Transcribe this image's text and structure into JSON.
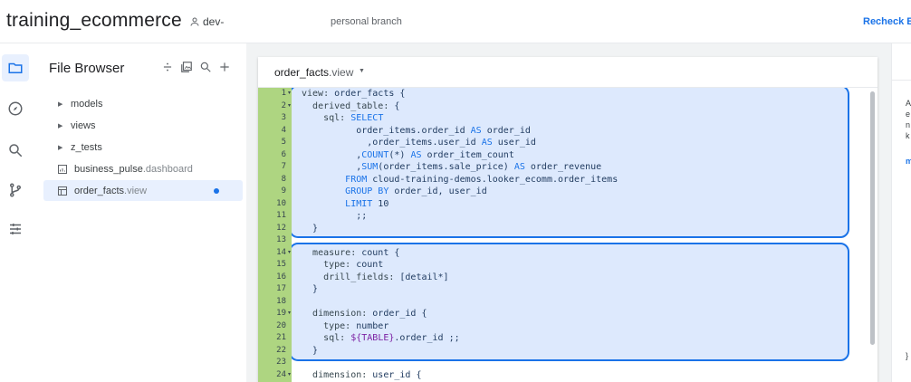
{
  "topbar": {
    "project_title": "training_ecommerce",
    "user": "dev-",
    "branch": "personal branch",
    "recheck": "Recheck Err"
  },
  "rail": {
    "items": [
      {
        "name": "folder-icon",
        "active": true
      },
      {
        "name": "compass-icon",
        "active": false
      },
      {
        "name": "search-icon",
        "active": false
      },
      {
        "name": "git-branch-icon",
        "active": false
      },
      {
        "name": "sliders-icon",
        "active": false
      }
    ]
  },
  "browser": {
    "title": "File Browser",
    "tools": [
      "divide-icon",
      "image-icon",
      "search-icon",
      "plus-icon"
    ],
    "items": [
      {
        "name": "models",
        "ext": "",
        "type": "folder"
      },
      {
        "name": "views",
        "ext": "",
        "type": "folder"
      },
      {
        "name": "z_tests",
        "ext": "",
        "type": "folder"
      },
      {
        "name": "business_pulse",
        "ext": ".dashboard",
        "type": "dashboard"
      },
      {
        "name": "order_facts",
        "ext": ".view",
        "type": "view",
        "selected": true,
        "modified": true
      }
    ]
  },
  "editor": {
    "tab_name": "order_facts",
    "tab_ext": ".view",
    "line_numbers": [
      "1",
      "2",
      "3",
      "4",
      "5",
      "6",
      "7",
      "8",
      "9",
      "10",
      "11",
      "12",
      "13",
      "14",
      "15",
      "16",
      "17",
      "18",
      "19",
      "20",
      "21",
      "22",
      "23",
      "24"
    ],
    "fold_lines": [
      1,
      2,
      14,
      19,
      24
    ],
    "lines": [
      "view: order_facts {",
      "  derived_table: {",
      "    sql: SELECT",
      "          order_items.order_id AS order_id",
      "            ,order_items.user_id AS user_id",
      "          ,COUNT(*) AS order_item_count",
      "          ,SUM(order_items.sale_price) AS order_revenue",
      "        FROM cloud-training-demos.looker_ecomm.order_items",
      "        GROUP BY order_id, user_id",
      "        LIMIT 10",
      "          ;;",
      "  }",
      "",
      "  measure: count {",
      "    type: count",
      "    drill_fields: [detail*]",
      "  }",
      "",
      "  dimension: order_id {",
      "    type: number",
      "    sql: ${TABLE}.order_id ;;",
      "  }",
      "",
      "  dimension: user_id {"
    ]
  },
  "side_panel": {
    "letters": [
      "A",
      "e",
      "n",
      "k",
      "m",
      "}"
    ]
  },
  "colors": {
    "accent": "#1a73e8",
    "gutter": "#aed581",
    "selection": "#d2e3fc"
  }
}
